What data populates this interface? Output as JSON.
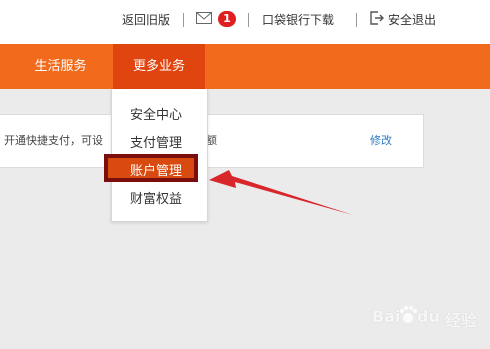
{
  "topbar": {
    "back_old": "返回旧版",
    "mail_badge": "1",
    "pocket_bank": "口袋银行下载",
    "logout": "安全退出"
  },
  "nav": {
    "life_services": "生活服务",
    "more_business": "更多业务"
  },
  "panel": {
    "text_left": "开通快捷支付，可设",
    "text_right": "额",
    "edit": "修改"
  },
  "dropdown": {
    "items": [
      "安全中心",
      "支付管理",
      "账户管理",
      "财富权益"
    ],
    "highlighted": "账户管理"
  },
  "colors": {
    "nav_orange": "#f26b1d",
    "nav_active": "#e0450f",
    "highlight_bg": "#d84a10",
    "highlight_border": "#7a0d0d",
    "arrow_red": "#d9262a",
    "badge_red": "#e02020"
  },
  "watermark": {
    "brand": "Bai",
    "brand_paw": "du",
    "label": "经验"
  }
}
